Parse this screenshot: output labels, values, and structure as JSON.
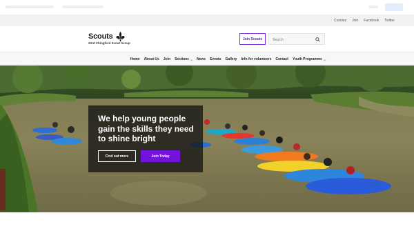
{
  "utility_links": [
    "Cookies",
    "Join",
    "Facebook",
    "Twitter"
  ],
  "logo": {
    "wordmark": "Scouts",
    "group_name": "23rd Chingford Scout Group"
  },
  "header": {
    "join_button": "Join Scouts",
    "search_placeholder": "Search"
  },
  "nav": [
    {
      "label": "Home",
      "dropdown": false
    },
    {
      "label": "About Us",
      "dropdown": false
    },
    {
      "label": "Join",
      "dropdown": false
    },
    {
      "label": "Sections",
      "dropdown": true
    },
    {
      "label": "News",
      "dropdown": false
    },
    {
      "label": "Events",
      "dropdown": false
    },
    {
      "label": "Gallery",
      "dropdown": false
    },
    {
      "label": "Info for volunteers",
      "dropdown": false
    },
    {
      "label": "Contact",
      "dropdown": false
    },
    {
      "label": "Youth Programme",
      "dropdown": true
    }
  ],
  "hero": {
    "heading": "We help young people gain the skills they need to shine bright",
    "primary_button": "Join Today",
    "secondary_button": "Find out more"
  },
  "colors": {
    "brand_purple": "#7413dc",
    "overlay": "#141414"
  },
  "icons": {
    "logo_mark": "fleur-de-lis-icon",
    "search": "search-icon",
    "dropdown": "chevron-down-icon"
  }
}
